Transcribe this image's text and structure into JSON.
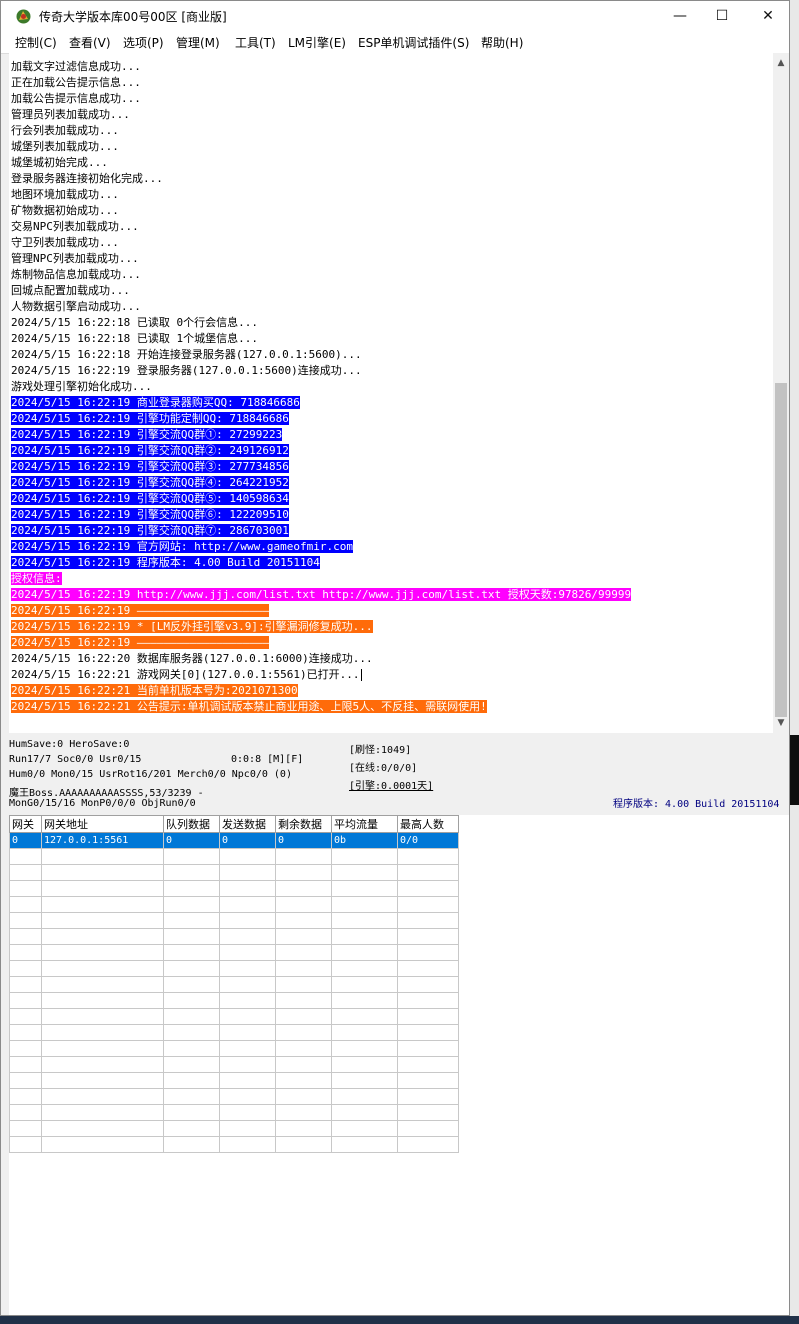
{
  "window": {
    "title": "传奇大学版本库00号00区 [商业版]",
    "controls": {
      "minimize": "—",
      "maximize": "☐",
      "close": "✕"
    }
  },
  "menu": [
    "控制(C)",
    "查看(V)",
    "选项(P)",
    "管理(M)",
    "工具(T)",
    "LM引擎(E)",
    "ESP单机调试插件(S)",
    "帮助(H)"
  ],
  "log": [
    {
      "text": "加载文字过滤信息成功...",
      "style": ""
    },
    {
      "text": "正在加载公告提示信息...",
      "style": ""
    },
    {
      "text": "加载公告提示信息成功...",
      "style": ""
    },
    {
      "text": "管理员列表加载成功...",
      "style": ""
    },
    {
      "text": "行会列表加载成功...",
      "style": ""
    },
    {
      "text": "城堡列表加载成功...",
      "style": ""
    },
    {
      "text": "城堡城初始完成...",
      "style": ""
    },
    {
      "text": "登录服务器连接初始化完成...",
      "style": ""
    },
    {
      "text": "地图环境加载成功...",
      "style": ""
    },
    {
      "text": "矿物数据初始成功...",
      "style": ""
    },
    {
      "text": "交易NPC列表加载成功...",
      "style": ""
    },
    {
      "text": "守卫列表加载成功...",
      "style": ""
    },
    {
      "text": "管理NPC列表加载成功...",
      "style": ""
    },
    {
      "text": "炼制物品信息加载成功...",
      "style": ""
    },
    {
      "text": "回城点配置加载成功...",
      "style": ""
    },
    {
      "text": "人物数据引擎启动成功...",
      "style": ""
    },
    {
      "text": "2024/5/15 16:22:18 已读取 0个行会信息...",
      "style": ""
    },
    {
      "text": "2024/5/15 16:22:18 已读取 1个城堡信息...",
      "style": ""
    },
    {
      "text": "2024/5/15 16:22:18 开始连接登录服务器(127.0.0.1:5600)...",
      "style": ""
    },
    {
      "text": "2024/5/15 16:22:19 登录服务器(127.0.0.1:5600)连接成功...",
      "style": ""
    },
    {
      "text": "游戏处理引擎初始化成功...",
      "style": ""
    },
    {
      "text": "2024/5/15 16:22:19 商业登录器购买QQ: 718846686",
      "style": "blue"
    },
    {
      "text": "2024/5/15 16:22:19 引擎功能定制QQ: 718846686",
      "style": "blue"
    },
    {
      "text": "2024/5/15 16:22:19 引擎交流QQ群①: 27299223",
      "style": "blue"
    },
    {
      "text": "2024/5/15 16:22:19 引擎交流QQ群②: 249126912",
      "style": "blue"
    },
    {
      "text": "2024/5/15 16:22:19 引擎交流QQ群③: 277734856",
      "style": "blue"
    },
    {
      "text": "2024/5/15 16:22:19 引擎交流QQ群④: 264221952",
      "style": "blue"
    },
    {
      "text": "2024/5/15 16:22:19 引擎交流QQ群⑤: 140598634",
      "style": "blue"
    },
    {
      "text": "2024/5/15 16:22:19 引擎交流QQ群⑥: 122209510",
      "style": "blue"
    },
    {
      "text": "2024/5/15 16:22:19 引擎交流QQ群⑦: 286703001",
      "style": "blue"
    },
    {
      "text": "2024/5/15 16:22:19 官方网站: http://www.gameofmir.com",
      "style": "blue"
    },
    {
      "text": "2024/5/15 16:22:19 程序版本: 4.00 Build 20151104",
      "style": "blue"
    },
    {
      "text": "授权信息:",
      "style": "magenta"
    },
    {
      "text": "2024/5/15 16:22:19 http://www.jjj.com/list.txt http://www.jjj.com/list.txt 授权天数:97826/99999",
      "style": "magenta"
    },
    {
      "text": "2024/5/15 16:22:19 ————————————————————",
      "style": "orange"
    },
    {
      "text": "2024/5/15 16:22:19 * [LM反外挂引擎v3.9]:引擎漏洞修复成功...",
      "style": "orange"
    },
    {
      "text": "2024/5/15 16:22:19 ————————————————————",
      "style": "orange"
    },
    {
      "text": "2024/5/15 16:22:20 数据库服务器(127.0.0.1:6000)连接成功...",
      "style": ""
    },
    {
      "text": "2024/5/15 16:22:21 游戏网关[0](127.0.0.1:5561)已打开...",
      "style": "caret"
    },
    {
      "text": "2024/5/15 16:22:21 当前单机版本号为:2021071300",
      "style": "orange"
    },
    {
      "text": "2024/5/15 16:22:21 公告提示:单机调试版本禁止商业用途、上限5人、不反挂、需联网使用!",
      "style": "orange"
    }
  ],
  "status": {
    "line1": "HumSave:0 HeroSave:0",
    "line2": "Run17/7 Soc0/0 Usr0/15",
    "line2_right": "0:0:8 [M][F]",
    "line3": "Hum0/0 Mon0/15 UsrRot16/201 Merch0/0 Npc0/0 (0)",
    "line4": "魔王Boss.AAAAAAAAAASSSS,53/3239 -",
    "line5": "MonG0/15/16 MonP0/0/0 ObjRun0/0",
    "refresh": "[刷怪:1049]",
    "online": "[在线:0/0/0]",
    "engine": "[引擎:0.0001天]",
    "version": "程序版本: 4.00 Build 20151104"
  },
  "grid": {
    "headers": [
      "网关",
      "网关地址",
      "队列数据",
      "发送数据",
      "剩余数据",
      "平均流量",
      "最高人数"
    ],
    "rows": [
      [
        "0",
        "127.0.0.1:5561",
        "0",
        "0",
        "0",
        "0b",
        "0/0"
      ]
    ],
    "empty_rows": 19
  }
}
